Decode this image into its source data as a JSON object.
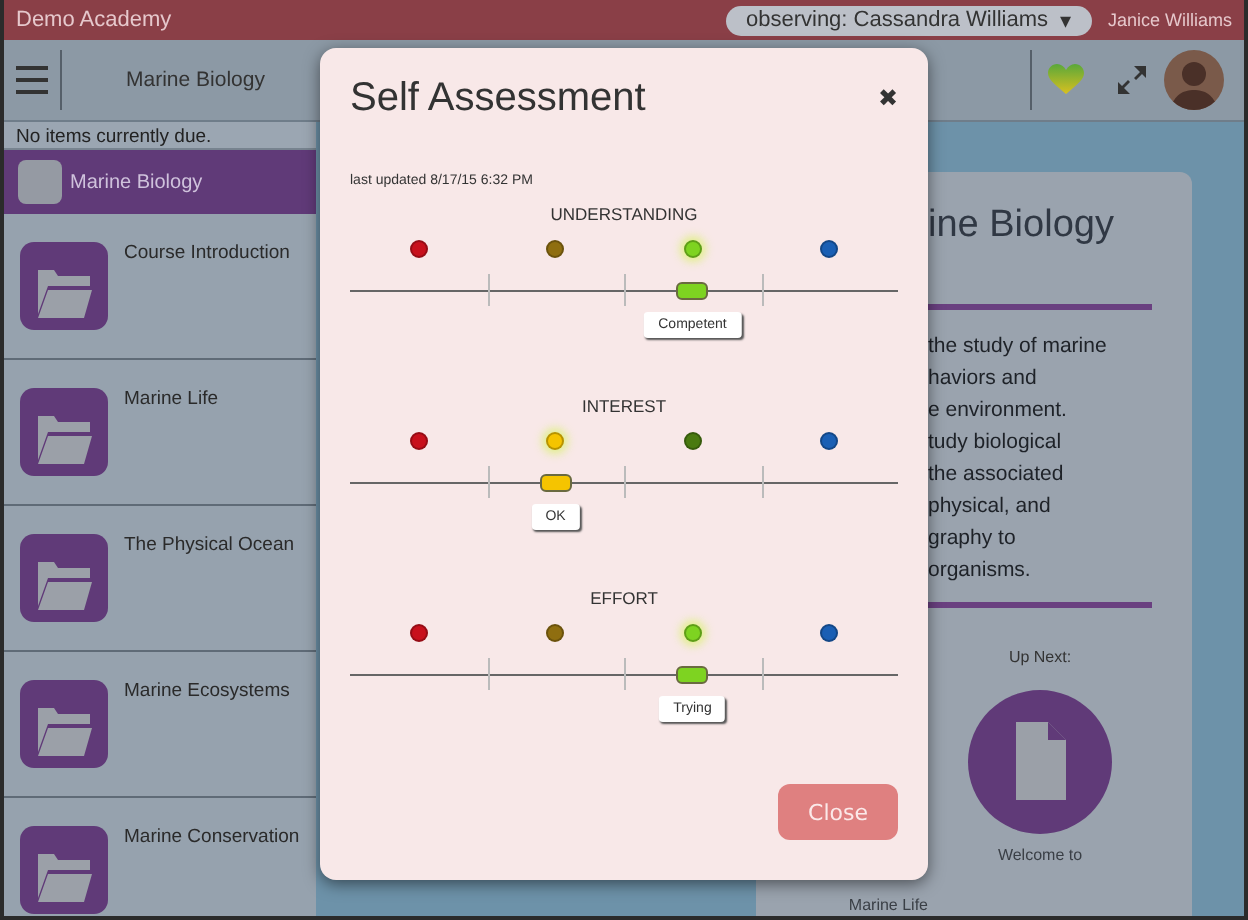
{
  "top_bar": {
    "school": "Demo Academy",
    "observing": "observing: Cassandra Williams",
    "caret": "▾",
    "user": "Janice Williams"
  },
  "toolbar": {
    "course": "Marine Biology"
  },
  "sidebar": {
    "notice": "No items currently due.",
    "header": "Marine Biology",
    "items": [
      {
        "title": "Course Introduction"
      },
      {
        "title": "Marine Life"
      },
      {
        "title": "The Physical Ocean"
      },
      {
        "title": "Marine Ecosystems"
      },
      {
        "title": "Marine Conservation"
      }
    ]
  },
  "course_card": {
    "title": "ine Biology",
    "lines": [
      "the study of marine",
      "haviors and",
      "e environment.",
      "tudy biological",
      "the associated",
      "physical, and",
      "graphy to",
      "organisms."
    ],
    "up_next": "Up Next:",
    "next_title": "Welcome to",
    "previous_title": "Marine Life"
  },
  "dialog": {
    "title": "Self Assessment",
    "close_icon": "✖",
    "last_updated": "last updated 8/17/15 6:32 PM",
    "button": "Close",
    "sections": [
      {
        "label": "UNDERSTANDING",
        "level": 0.625,
        "value": "Competent",
        "options": [
          {
            "color": "#c8101c",
            "selected": false
          },
          {
            "color": "#8f6e10",
            "selected": false
          },
          {
            "color": "#7ed321",
            "selected": true
          },
          {
            "color": "#1a5fb4",
            "selected": false
          }
        ]
      },
      {
        "label": "INTEREST",
        "level": 0.375,
        "value": "OK",
        "options": [
          {
            "color": "#c8101c",
            "selected": false
          },
          {
            "color": "#f5c400",
            "selected": true
          },
          {
            "color": "#4a7a10",
            "selected": false
          },
          {
            "color": "#1a5fb4",
            "selected": false
          }
        ]
      },
      {
        "label": "EFFORT",
        "level": 0.625,
        "value": "Trying",
        "options": [
          {
            "color": "#c8101c",
            "selected": false
          },
          {
            "color": "#8f6e10",
            "selected": false
          },
          {
            "color": "#7ed321",
            "selected": true
          },
          {
            "color": "#1a5fb4",
            "selected": false
          }
        ]
      }
    ]
  }
}
